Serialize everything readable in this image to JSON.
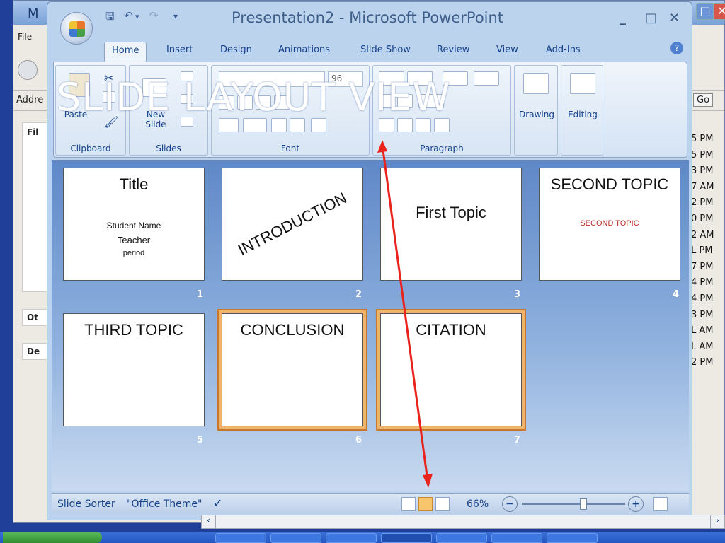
{
  "overlay_title": "SLIDE LAYOUT VIEW",
  "background_window": {
    "title_partial": "M",
    "menu_file": "File",
    "address_label": "Addre",
    "go_button": "Go",
    "left_labels": [
      "Fil",
      "Ot",
      "De"
    ],
    "times": [
      "5 PM",
      "5 PM",
      "3 PM",
      "7 AM",
      "2 PM",
      "0 PM",
      "2 AM",
      "L PM",
      "7 PM",
      "4 PM",
      "4 PM",
      "3 PM",
      "L AM",
      "L AM",
      "2 PM"
    ]
  },
  "window": {
    "title": "Presentation2 - Microsoft PowerPoint",
    "minimize": "_",
    "maximize": "□",
    "close": "✕"
  },
  "tabs": [
    {
      "label": "Home",
      "active": true
    },
    {
      "label": "Insert"
    },
    {
      "label": "Design"
    },
    {
      "label": "Animations"
    },
    {
      "label": "Slide Show"
    },
    {
      "label": "Review"
    },
    {
      "label": "View"
    },
    {
      "label": "Add-Ins"
    }
  ],
  "ribbon": {
    "groups": {
      "clipboard": "Clipboard",
      "slides": "Slides",
      "font": "Font",
      "paragraph": "Paragraph"
    },
    "paste": "Paste",
    "new_slide": "New Slide",
    "font_size": "96",
    "drawing": "Drawing",
    "editing": "Editing"
  },
  "slides": [
    {
      "num": "1",
      "title": "Title",
      "lines": [
        "Student Name",
        "Teacher",
        "period"
      ]
    },
    {
      "num": "2",
      "title": "INTRODUCTION"
    },
    {
      "num": "3",
      "title": "First Topic"
    },
    {
      "num": "4",
      "title": "SECOND TOPIC",
      "subtitle": "SECOND TOPIC"
    },
    {
      "num": "5",
      "title": "THIRD TOPIC"
    },
    {
      "num": "6",
      "title": "CONCLUSION",
      "selected": true
    },
    {
      "num": "7",
      "title": "CITATION",
      "selected": true
    }
  ],
  "status": {
    "view_name": "Slide Sorter",
    "theme": "\"Office Theme\"",
    "zoom": "66%"
  },
  "colors": {
    "arrow": "#e8241c",
    "slide_subtitle_red": "#c0302a",
    "selection": "#f0b36a"
  }
}
